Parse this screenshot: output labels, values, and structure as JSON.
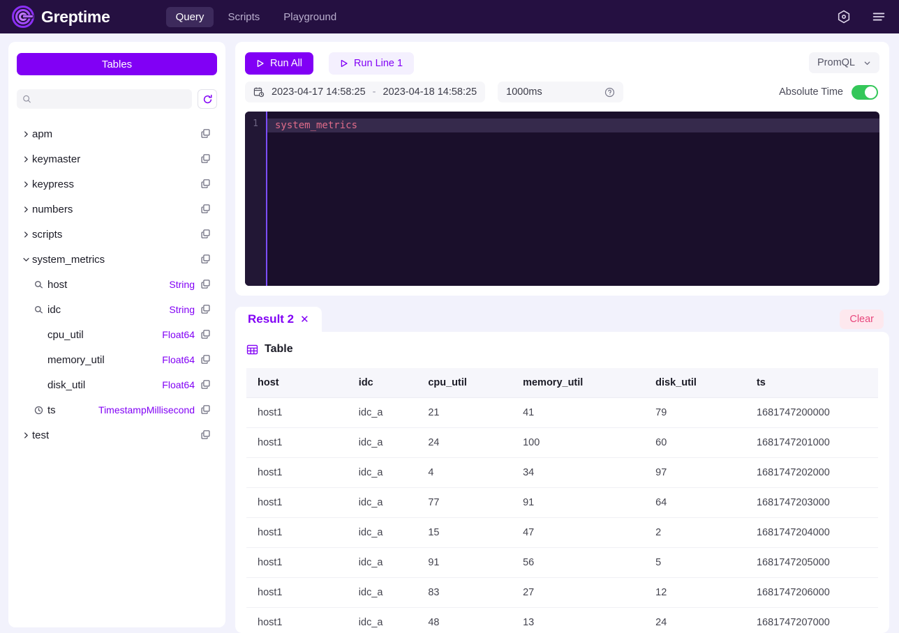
{
  "app": {
    "brand_name": "Greptime",
    "nav_items": [
      {
        "label": "Query",
        "active": true
      },
      {
        "label": "Scripts",
        "active": false
      },
      {
        "label": "Playground",
        "active": false
      }
    ],
    "settings_icon": "gear-hexagon-icon",
    "menu_icon": "hamburger-menu-icon"
  },
  "sidebar": {
    "tables_button": "Tables",
    "search_placeholder": "",
    "search_value": "",
    "search_icon": "search-icon",
    "refresh_icon": "refresh-icon",
    "tree": [
      {
        "label": "apm",
        "level": 0,
        "expanded": false,
        "icon": "chevron-right-icon",
        "dtype": ""
      },
      {
        "label": "keymaster",
        "level": 0,
        "expanded": false,
        "icon": "chevron-right-icon",
        "dtype": ""
      },
      {
        "label": "keypress",
        "level": 0,
        "expanded": false,
        "icon": "chevron-right-icon",
        "dtype": ""
      },
      {
        "label": "numbers",
        "level": 0,
        "expanded": false,
        "icon": "chevron-right-icon",
        "dtype": ""
      },
      {
        "label": "scripts",
        "level": 0,
        "expanded": false,
        "icon": "chevron-right-icon",
        "dtype": ""
      },
      {
        "label": "system_metrics",
        "level": 0,
        "expanded": true,
        "icon": "chevron-down-icon",
        "dtype": ""
      },
      {
        "label": "host",
        "level": 1,
        "expanded": false,
        "icon": "tag-key-icon",
        "dtype": "String"
      },
      {
        "label": "idc",
        "level": 1,
        "expanded": false,
        "icon": "tag-key-icon",
        "dtype": "String"
      },
      {
        "label": "cpu_util",
        "level": 1,
        "expanded": false,
        "icon": "",
        "dtype": "Float64"
      },
      {
        "label": "memory_util",
        "level": 1,
        "expanded": false,
        "icon": "",
        "dtype": "Float64"
      },
      {
        "label": "disk_util",
        "level": 1,
        "expanded": false,
        "icon": "",
        "dtype": "Float64"
      },
      {
        "label": "ts",
        "level": 1,
        "expanded": false,
        "icon": "clock-icon",
        "dtype": "TimestampMillisecond"
      },
      {
        "label": "test",
        "level": 0,
        "expanded": false,
        "icon": "chevron-right-icon",
        "dtype": ""
      }
    ],
    "copy_icon": "copy-icon"
  },
  "editor": {
    "run_all_label": "Run All",
    "run_line_label": "Run Line 1",
    "play_icon": "play-triangle-icon",
    "language": "PromQL",
    "language_chevron": "chevron-down-icon",
    "calendar_icon": "calendar-clock-icon",
    "time_from": "2023-04-17 14:58:25",
    "time_separator": "-",
    "time_to": "2023-04-18 14:58:25",
    "step_value": "1000ms",
    "help_icon": "question-circle-icon",
    "absolute_time_label": "Absolute Time",
    "absolute_time_on": true,
    "line_number": "1",
    "code": "system_metrics"
  },
  "result": {
    "tab_label": "Result 2",
    "tab_close_icon": "close-icon",
    "clear_label": "Clear",
    "view_label": "Table",
    "table_icon": "table-grid-icon",
    "columns": [
      "host",
      "idc",
      "cpu_util",
      "memory_util",
      "disk_util",
      "ts"
    ],
    "rows": [
      [
        "host1",
        "idc_a",
        "21",
        "41",
        "79",
        "1681747200000"
      ],
      [
        "host1",
        "idc_a",
        "24",
        "100",
        "60",
        "1681747201000"
      ],
      [
        "host1",
        "idc_a",
        "4",
        "34",
        "97",
        "1681747202000"
      ],
      [
        "host1",
        "idc_a",
        "77",
        "91",
        "64",
        "1681747203000"
      ],
      [
        "host1",
        "idc_a",
        "15",
        "47",
        "2",
        "1681747204000"
      ],
      [
        "host1",
        "idc_a",
        "91",
        "56",
        "5",
        "1681747205000"
      ],
      [
        "host1",
        "idc_a",
        "83",
        "27",
        "12",
        "1681747206000"
      ],
      [
        "host1",
        "idc_a",
        "48",
        "13",
        "24",
        "1681747207000"
      ]
    ]
  },
  "colors": {
    "brand_purple": "#8100f5",
    "header_bg": "#251041",
    "page_bg": "#f2f2fc",
    "toggle_on": "#34c759",
    "clear_text": "#e8467c",
    "code_text": "#e06c8a"
  }
}
